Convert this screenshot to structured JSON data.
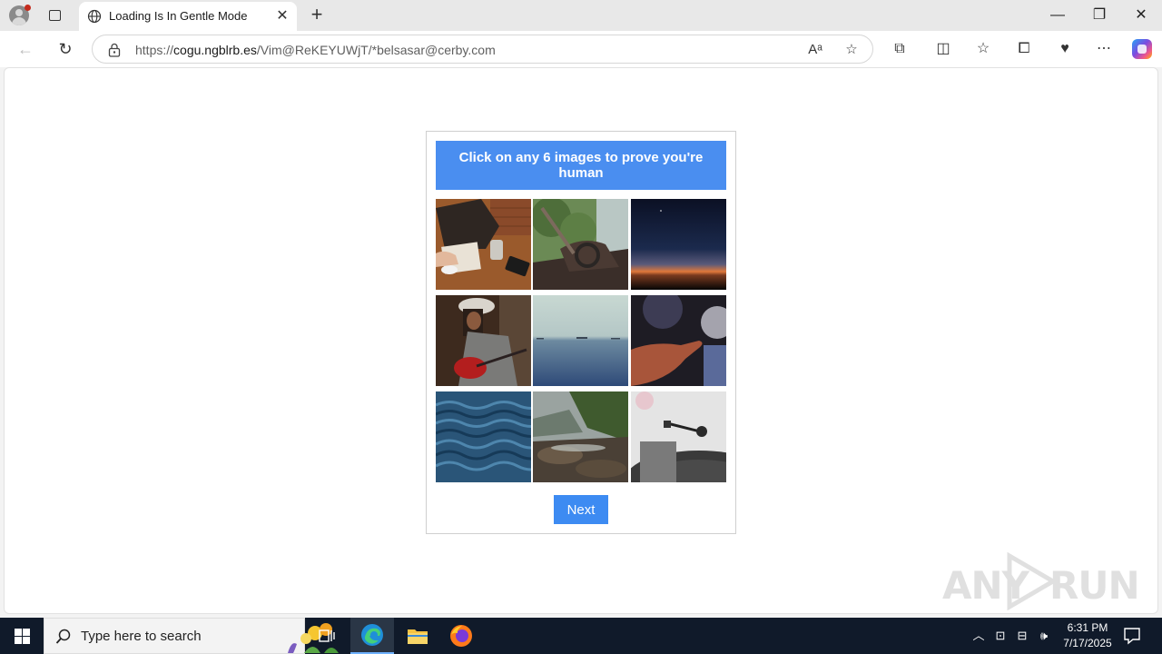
{
  "browser": {
    "tab_title": "Loading Is In Gentle Mode",
    "url_prefix": "https://",
    "url_host": "cogu.ngblrb.es",
    "url_path": "/Vim@ReKEYUWjT/*belsasar@cerby.com"
  },
  "captcha": {
    "instruction": "Click on any 6 images to prove you're human",
    "next_label": "Next",
    "tiles": [
      "laptop-bag-coffee-table",
      "motorcycle-in-forest",
      "sunset-horizon",
      "woman-playing-guitar",
      "calm-sea-ships",
      "hand-touching-screen",
      "ocean-waves",
      "rocky-river-shore",
      "record-player"
    ]
  },
  "watermark": {
    "text_left": "ANY",
    "text_right": "RUN"
  },
  "taskbar": {
    "search_placeholder": "Type here to search",
    "time": "6:31 PM",
    "date": "7/17/2025"
  },
  "colors": {
    "captcha_header": "#4a8ef0",
    "next_button": "#3d8bf2",
    "taskbar": "#101a2a"
  }
}
